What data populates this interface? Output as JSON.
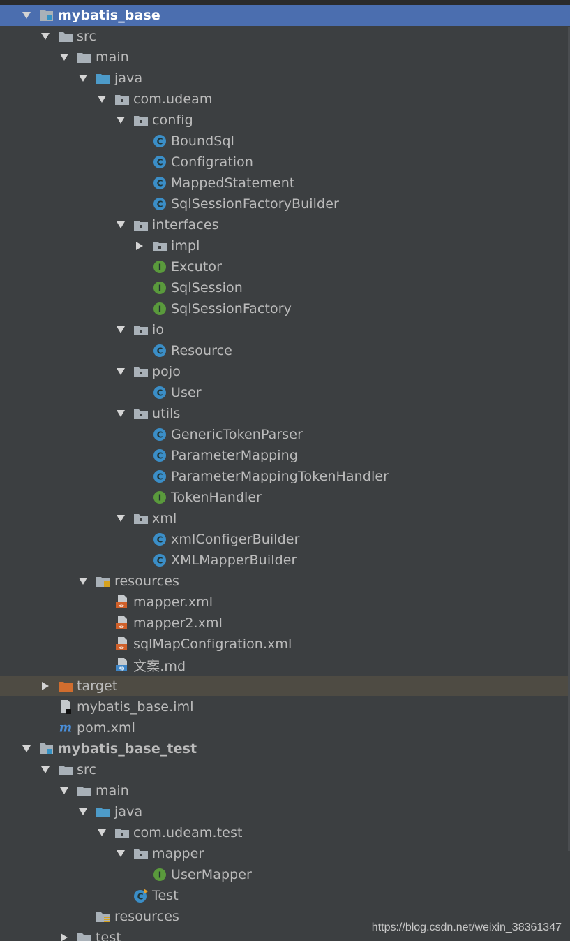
{
  "colors": {
    "background": "#3c3f41",
    "text": "#bbbbbb",
    "selection": "#4b6eaf",
    "excluded_row": "#4e4b43",
    "class_icon": "#3b8ec7",
    "interface_icon": "#5a9a3c",
    "folder_source": "#4d9bc9",
    "folder_excluded": "#d06d2e",
    "folder_plain": "#a9b1b8"
  },
  "tree": [
    {
      "label": "mybatis_base",
      "depth": 0,
      "icon": "module-icon",
      "arrow": "expanded",
      "state": "selected",
      "bold": true
    },
    {
      "label": "src",
      "depth": 1,
      "icon": "folder-icon",
      "arrow": "expanded"
    },
    {
      "label": "main",
      "depth": 2,
      "icon": "folder-icon",
      "arrow": "expanded"
    },
    {
      "label": "java",
      "depth": 3,
      "icon": "source-folder-icon",
      "arrow": "expanded"
    },
    {
      "label": "com.udeam",
      "depth": 4,
      "icon": "package-icon",
      "arrow": "expanded"
    },
    {
      "label": "config",
      "depth": 5,
      "icon": "package-icon",
      "arrow": "expanded"
    },
    {
      "label": "BoundSql",
      "depth": 6,
      "icon": "class-icon",
      "arrow": "none"
    },
    {
      "label": "Configration",
      "depth": 6,
      "icon": "class-icon",
      "arrow": "none"
    },
    {
      "label": "MappedStatement",
      "depth": 6,
      "icon": "class-icon",
      "arrow": "none"
    },
    {
      "label": "SqlSessionFactoryBuilder",
      "depth": 6,
      "icon": "class-icon",
      "arrow": "none"
    },
    {
      "label": "interfaces",
      "depth": 5,
      "icon": "package-icon",
      "arrow": "expanded"
    },
    {
      "label": "impl",
      "depth": 6,
      "icon": "package-icon",
      "arrow": "collapsed"
    },
    {
      "label": "Excutor",
      "depth": 6,
      "icon": "interface-icon",
      "arrow": "none"
    },
    {
      "label": "SqlSession",
      "depth": 6,
      "icon": "interface-icon",
      "arrow": "none"
    },
    {
      "label": "SqlSessionFactory",
      "depth": 6,
      "icon": "interface-icon",
      "arrow": "none"
    },
    {
      "label": "io",
      "depth": 5,
      "icon": "package-icon",
      "arrow": "expanded"
    },
    {
      "label": "Resource",
      "depth": 6,
      "icon": "class-icon",
      "arrow": "none"
    },
    {
      "label": "pojo",
      "depth": 5,
      "icon": "package-icon",
      "arrow": "expanded"
    },
    {
      "label": "User",
      "depth": 6,
      "icon": "class-icon",
      "arrow": "none"
    },
    {
      "label": "utils",
      "depth": 5,
      "icon": "package-icon",
      "arrow": "expanded"
    },
    {
      "label": "GenericTokenParser",
      "depth": 6,
      "icon": "class-icon",
      "arrow": "none"
    },
    {
      "label": "ParameterMapping",
      "depth": 6,
      "icon": "class-icon",
      "arrow": "none"
    },
    {
      "label": "ParameterMappingTokenHandler",
      "depth": 6,
      "icon": "class-icon",
      "arrow": "none"
    },
    {
      "label": "TokenHandler",
      "depth": 6,
      "icon": "interface-icon",
      "arrow": "none"
    },
    {
      "label": "xml",
      "depth": 5,
      "icon": "package-icon",
      "arrow": "expanded"
    },
    {
      "label": "xmlConfigerBuilder",
      "depth": 6,
      "icon": "class-icon",
      "arrow": "none"
    },
    {
      "label": "XMLMapperBuilder",
      "depth": 6,
      "icon": "class-icon",
      "arrow": "none"
    },
    {
      "label": "resources",
      "depth": 3,
      "icon": "resources-folder-icon",
      "arrow": "expanded"
    },
    {
      "label": "mapper.xml",
      "depth": 4,
      "icon": "xml-file-icon",
      "arrow": "none"
    },
    {
      "label": "mapper2.xml",
      "depth": 4,
      "icon": "xml-file-icon",
      "arrow": "none"
    },
    {
      "label": "sqlMapConfigration.xml",
      "depth": 4,
      "icon": "xml-file-icon",
      "arrow": "none"
    },
    {
      "label": "文案.md",
      "depth": 4,
      "icon": "md-file-icon",
      "arrow": "none"
    },
    {
      "label": "target",
      "depth": 1,
      "icon": "excluded-folder-icon",
      "arrow": "collapsed",
      "state": "highlight"
    },
    {
      "label": "mybatis_base.iml",
      "depth": 2,
      "icon": "iml-file-icon",
      "arrow": "none",
      "indent_override": 1
    },
    {
      "label": "pom.xml",
      "depth": 2,
      "icon": "maven-icon",
      "arrow": "none",
      "indent_override": 1
    },
    {
      "label": "mybatis_base_test",
      "depth": 0,
      "icon": "module-icon",
      "arrow": "expanded",
      "bold": true
    },
    {
      "label": "src",
      "depth": 1,
      "icon": "folder-icon",
      "arrow": "expanded"
    },
    {
      "label": "main",
      "depth": 2,
      "icon": "folder-icon",
      "arrow": "expanded"
    },
    {
      "label": "java",
      "depth": 3,
      "icon": "source-folder-icon",
      "arrow": "expanded"
    },
    {
      "label": "com.udeam.test",
      "depth": 4,
      "icon": "package-icon",
      "arrow": "expanded"
    },
    {
      "label": "mapper",
      "depth": 5,
      "icon": "package-icon",
      "arrow": "expanded"
    },
    {
      "label": "UserMapper",
      "depth": 6,
      "icon": "interface-icon",
      "arrow": "none"
    },
    {
      "label": "Test",
      "depth": 5,
      "icon": "runnable-class-icon",
      "arrow": "none"
    },
    {
      "label": "resources",
      "depth": 3,
      "icon": "resources-folder-icon",
      "arrow": "none"
    },
    {
      "label": "test",
      "depth": 2,
      "icon": "folder-icon",
      "arrow": "collapsed"
    }
  ],
  "watermark": "https://blog.csdn.net/weixin_38361347"
}
